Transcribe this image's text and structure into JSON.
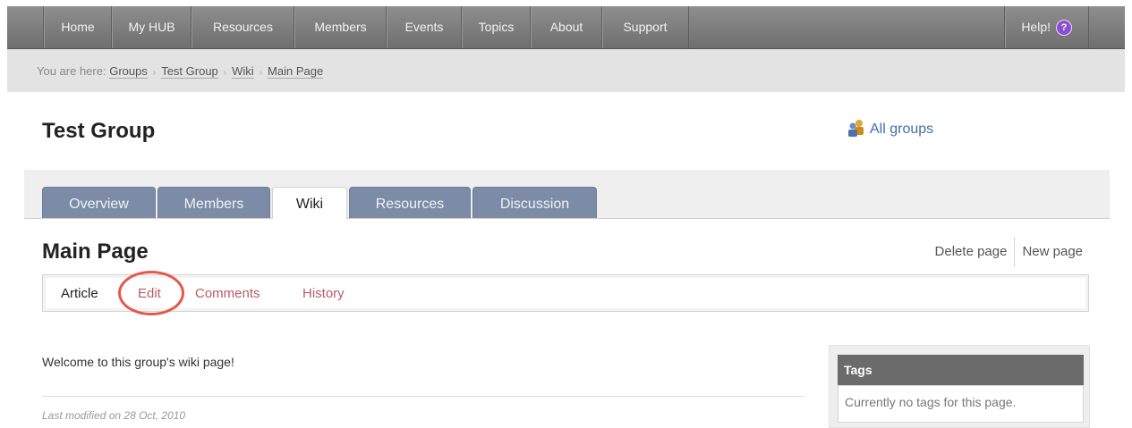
{
  "nav": {
    "items": [
      "Home",
      "My HUB",
      "Resources",
      "Members",
      "Events",
      "Topics",
      "About",
      "Support"
    ],
    "help_label": "Help!",
    "help_icon": "question-mark-icon"
  },
  "breadcrumb": {
    "prefix": "You are here:",
    "items": [
      "Groups",
      "Test Group",
      "Wiki",
      "Main Page"
    ],
    "separator": "›"
  },
  "group": {
    "title": "Test Group",
    "all_groups_label": "All groups",
    "all_groups_icon": "groups-icon"
  },
  "tabs": {
    "items": [
      "Overview",
      "Members",
      "Wiki",
      "Resources",
      "Discussion"
    ],
    "active": "Wiki"
  },
  "page": {
    "title": "Main Page",
    "delete_label": "Delete page",
    "new_label": "New page"
  },
  "subtabs": {
    "items": [
      "Article",
      "Edit",
      "Comments",
      "History"
    ],
    "current": "Article",
    "highlighted": "Edit"
  },
  "content": {
    "welcome": "Welcome to this group's wiki page!",
    "last_modified": "Last modified on 28 Oct, 2010"
  },
  "tags": {
    "header": "Tags",
    "empty_text": "Currently no tags for this page."
  },
  "colors": {
    "highlight_circle": "#e4584a",
    "tab_bg": "#7d8ca6",
    "link": "#b85c66"
  }
}
